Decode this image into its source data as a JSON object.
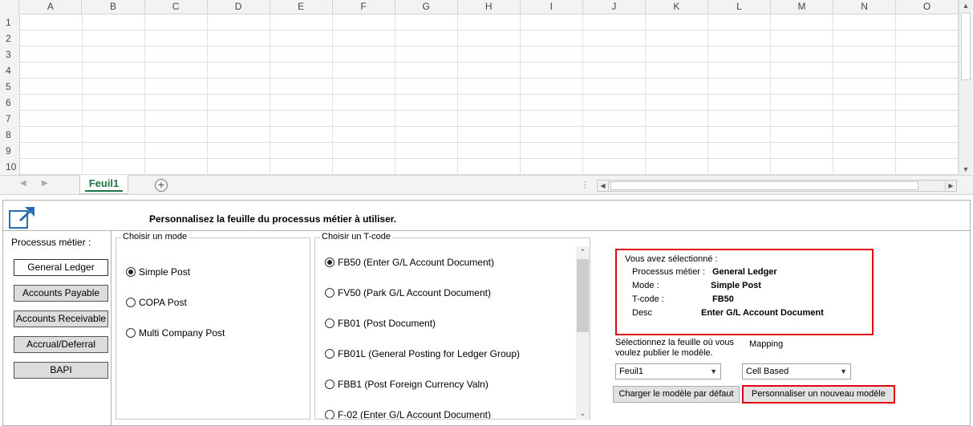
{
  "spreadsheet": {
    "columns": [
      "A",
      "B",
      "C",
      "D",
      "E",
      "F",
      "G",
      "H",
      "I",
      "J",
      "K",
      "L",
      "M",
      "N",
      "O"
    ],
    "rows": [
      "1",
      "2",
      "3",
      "4",
      "5",
      "6",
      "7",
      "8",
      "9",
      "10"
    ],
    "sheet_tab": "Feuil1",
    "add_sheet_symbol": "+",
    "tab_options_symbol": "⋮"
  },
  "pane": {
    "heading": "Personnalisez la feuille du processus métier à utiliser.",
    "logo_icon": "external-link-icon",
    "process": {
      "label": "Processus métier :",
      "items": [
        "General Ledger",
        "Accounts Payable",
        "Accounts Receivable",
        "Accrual/Deferral",
        "BAPI"
      ],
      "selected": "General Ledger"
    },
    "mode": {
      "title": "Choisir un mode",
      "options": [
        "Simple Post",
        "COPA Post",
        "Multi Company Post"
      ],
      "selected": "Simple Post"
    },
    "tcode": {
      "title": "Choisir un T-code",
      "options": [
        "FB50 (Enter G/L Account Document)",
        "FV50 (Park G/L Account Document)",
        "FB01 (Post Document)",
        "FB01L (General Posting for Ledger Group)",
        "FBB1 (Post Foreign Currency Valn)",
        "F-02 (Enter G/L Account Document)"
      ],
      "selected": "FB50 (Enter G/L Account Document)"
    },
    "summary": {
      "title": "Vous avez sélectionné :",
      "process_label": "Processus métier :",
      "process_value": "General Ledger",
      "mode_label": "Mode :",
      "mode_value": "Simple Post",
      "tcode_label": "T-code :",
      "tcode_value": "FB50",
      "desc_label": "Desc",
      "desc_value": "Enter G/L Account Document"
    },
    "publish": {
      "label": "Sélectionnez la feuille où vous voulez publier le modèle.",
      "sheet_value": "Feuil1",
      "mapping_label": "Mapping",
      "mapping_value": "Cell Based"
    },
    "buttons": {
      "load_default": "Charger le modèle par défaut",
      "customize": "Personnaliser un nouveau modèle"
    },
    "highlight_color": "#e30613",
    "tab_accent_color": "#217346"
  }
}
